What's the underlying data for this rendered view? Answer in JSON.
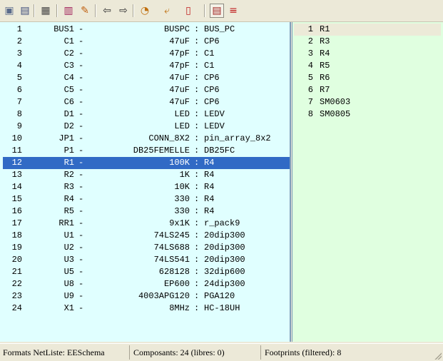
{
  "toolbar": {
    "buttons": [
      {
        "icon": "save-netlist-icon",
        "glyph": "▣"
      },
      {
        "icon": "open-icon",
        "glyph": "▤"
      },
      {
        "icon": "library-icon",
        "glyph": "▦"
      },
      {
        "icon": "module-icon",
        "glyph": "▥"
      },
      {
        "icon": "edit-icon",
        "glyph": "✎"
      },
      {
        "icon": "arrow-left-icon",
        "glyph": "⇦"
      },
      {
        "icon": "arrow-right-icon",
        "glyph": "⇨"
      },
      {
        "icon": "display-footprint-icon",
        "glyph": "◔"
      },
      {
        "icon": "associate-icon",
        "glyph": "⤶"
      },
      {
        "icon": "delete-associations-icon",
        "glyph": "▯"
      },
      {
        "icon": "list-filter-icon",
        "glyph": "▤"
      },
      {
        "icon": "stack-icon",
        "glyph": "≡"
      }
    ]
  },
  "components": [
    {
      "num": "1",
      "ref": "BUS1",
      "value": "BUSPC",
      "footprint": "BUS_PC"
    },
    {
      "num": "2",
      "ref": "C1",
      "value": "47uF",
      "footprint": "CP6"
    },
    {
      "num": "3",
      "ref": "C2",
      "value": "47pF",
      "footprint": "C1"
    },
    {
      "num": "4",
      "ref": "C3",
      "value": "47pF",
      "footprint": "C1"
    },
    {
      "num": "5",
      "ref": "C4",
      "value": "47uF",
      "footprint": "CP6"
    },
    {
      "num": "6",
      "ref": "C5",
      "value": "47uF",
      "footprint": "CP6"
    },
    {
      "num": "7",
      "ref": "C6",
      "value": "47uF",
      "footprint": "CP6"
    },
    {
      "num": "8",
      "ref": "D1",
      "value": "LED",
      "footprint": "LEDV"
    },
    {
      "num": "9",
      "ref": "D2",
      "value": "LED",
      "footprint": "LEDV"
    },
    {
      "num": "10",
      "ref": "JP1",
      "value": "CONN_8X2",
      "footprint": "pin_array_8x2"
    },
    {
      "num": "11",
      "ref": "P1",
      "value": "DB25FEMELLE",
      "footprint": "DB25FC"
    },
    {
      "num": "12",
      "ref": "R1",
      "value": "100K",
      "footprint": "R4"
    },
    {
      "num": "13",
      "ref": "R2",
      "value": "1K",
      "footprint": "R4"
    },
    {
      "num": "14",
      "ref": "R3",
      "value": "10K",
      "footprint": "R4"
    },
    {
      "num": "15",
      "ref": "R4",
      "value": "330",
      "footprint": "R4"
    },
    {
      "num": "16",
      "ref": "R5",
      "value": "330",
      "footprint": "R4"
    },
    {
      "num": "17",
      "ref": "RR1",
      "value": "9x1K",
      "footprint": "r_pack9"
    },
    {
      "num": "18",
      "ref": "U1",
      "value": "74LS245",
      "footprint": "20dip300"
    },
    {
      "num": "19",
      "ref": "U2",
      "value": "74LS688",
      "footprint": "20dip300"
    },
    {
      "num": "20",
      "ref": "U3",
      "value": "74LS541",
      "footprint": "20dip300"
    },
    {
      "num": "21",
      "ref": "U5",
      "value": "628128",
      "footprint": "32dip600"
    },
    {
      "num": "22",
      "ref": "U8",
      "value": "EP600",
      "footprint": "24dip300"
    },
    {
      "num": "23",
      "ref": "U9",
      "value": "4003APG120",
      "footprint": "PGA120"
    },
    {
      "num": "24",
      "ref": "X1",
      "value": "8MHz",
      "footprint": "HC-18UH"
    }
  ],
  "selected_component": "12",
  "separator_dash": "-",
  "separator_colon": ":",
  "footprints": [
    {
      "num": "1",
      "name": "R1"
    },
    {
      "num": "2",
      "name": "R3"
    },
    {
      "num": "3",
      "name": "R4"
    },
    {
      "num": "4",
      "name": "R5"
    },
    {
      "num": "5",
      "name": "R6"
    },
    {
      "num": "6",
      "name": "R7"
    },
    {
      "num": "7",
      "name": "SM0603"
    },
    {
      "num": "8",
      "name": "SM0805"
    }
  ],
  "selected_footprint": "1",
  "statusbar": {
    "format": "Formats NetListe: EESchema",
    "components": "Composants: 24 (libres: 0)",
    "footprints": "Footprints (filtered): 8"
  },
  "colors": {
    "components_bg": "#e0ffff",
    "footprints_bg": "#e0ffe0",
    "selection": "#316ac5"
  }
}
